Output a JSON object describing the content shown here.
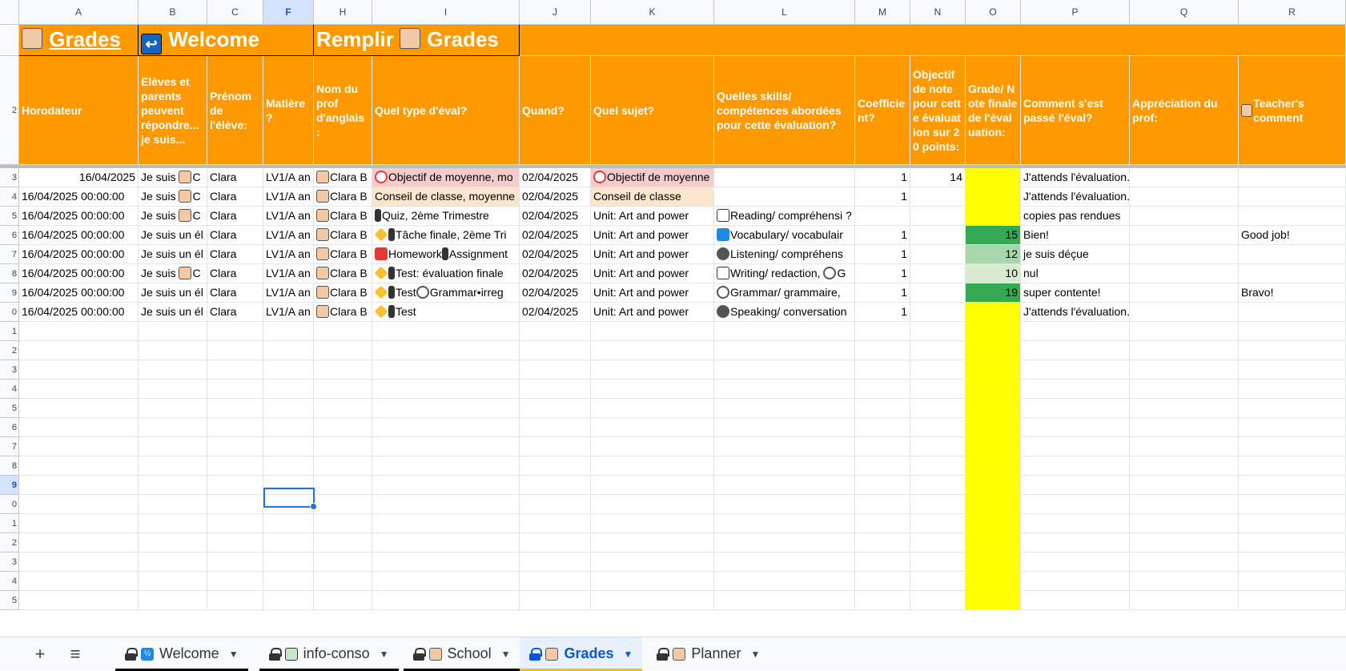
{
  "columns": [
    "A",
    "B",
    "C",
    "F",
    "H",
    "I",
    "J",
    "K",
    "L",
    "M",
    "N",
    "O",
    "P",
    "Q",
    "R"
  ],
  "selected_column": "F",
  "row_numbers": [
    "2",
    "3",
    "4",
    "5",
    "6",
    "7",
    "8",
    "9",
    "0",
    "1",
    "2",
    "3",
    "4",
    "5",
    "6",
    "7",
    "8",
    "9",
    "0",
    "1",
    "2",
    "3",
    "4",
    "5"
  ],
  "selected_row_label": "9",
  "banner": {
    "grades_link": "Grades",
    "welcome": "Welcome",
    "remplir": "Remplir",
    "grades2": "Grades"
  },
  "headers": {
    "horodateur": "Horodateur",
    "eleves": "Elèves et parents peuvent répondre... je suis...",
    "prenom": "Prénom de l'élève:",
    "matiere": "Matière ?",
    "nom_prof": "Nom du prof d'anglais :",
    "type_eval": "Quel type d'éval?",
    "quand": "Quand?",
    "sujet": "Quel sujet?",
    "skills": "Quelles skills/ compétences abordées pour cette évaluation?",
    "coeff": "Coefficient?",
    "objectif": "Objectif de note pour cette évaluation sur 20 points:",
    "grade": "Grade/ Note finale de l'évaluation:",
    "comment": "Comment s'est passé l'éval?",
    "appreciation": "Appréciation du prof:",
    "teacher_comment": "Teacher's comment"
  },
  "rows": [
    {
      "a": "16/04/2025",
      "b": "Je suis",
      "b2": "C",
      "c": "Clara",
      "f": "LV1/A an",
      "h": "Clara B",
      "i": "Objectif de moyenne, mo",
      "j": "02/04/2025",
      "k": "Objectif de moyenne",
      "l": "",
      "m": "1",
      "n": "14",
      "o": "",
      "p": "J'attends l'évaluation.",
      "r": ""
    },
    {
      "a": "16/04/2025 00:00:00",
      "b": "Je suis",
      "b2": "C",
      "c": "Clara",
      "f": "LV1/A an",
      "h": "Clara B",
      "i": "Conseil de classe, moyenne",
      "j": "02/04/2025",
      "k": "Conseil de classe",
      "l": "",
      "m": "1",
      "n": "",
      "o": "",
      "p": "J'attends l'évaluation.",
      "r": ""
    },
    {
      "a": "16/04/2025 00:00:00",
      "b": "Je suis",
      "b2": "C",
      "c": "Clara",
      "f": "LV1/A an",
      "h": "Clara B",
      "i": "Quiz, 2ème Trimestre",
      "j": "02/04/2025",
      "k": "Unit: Art and power",
      "l": "Reading/ compréhensi",
      "l2": "?",
      "m": "",
      "n": "",
      "o": "",
      "p": "copies pas rendues",
      "r": ""
    },
    {
      "a": "16/04/2025 00:00:00",
      "b": "Je suis un él",
      "b2": "",
      "c": "Clara",
      "f": "LV1/A an",
      "h": "Clara B",
      "i": "Tâche finale, 2ème Tri",
      "j": "02/04/2025",
      "k": "Unit: Art and power",
      "l": "Vocabulary/ vocabulair",
      "m": "1",
      "n": "",
      "o": "15",
      "p": "Bien!",
      "r": "Good job!"
    },
    {
      "a": "16/04/2025 00:00:00",
      "b": "Je suis un él",
      "b2": "",
      "c": "Clara",
      "f": "LV1/A an",
      "h": "Clara B",
      "i": "Homework",
      "i2": "Assignment",
      "j": "02/04/2025",
      "k": "Unit: Art and power",
      "l": "Listening/ compréhens",
      "m": "1",
      "n": "",
      "o": "12",
      "p": "je suis déçue",
      "r": ""
    },
    {
      "a": "16/04/2025 00:00:00",
      "b": "Je suis",
      "b2": "C",
      "c": "Clara",
      "f": "LV1/A an",
      "h": "Clara B",
      "i": "Test: évaluation finale",
      "j": "02/04/2025",
      "k": "Unit: Art and power",
      "l": "Writing/ redaction,",
      "l2": "G",
      "m": "1",
      "n": "",
      "o": "10",
      "p": "nul",
      "r": ""
    },
    {
      "a": "16/04/2025 00:00:00",
      "b": "Je suis un él",
      "b2": "",
      "c": "Clara",
      "f": "LV1/A an",
      "h": "Clara B",
      "i": "Test",
      "i2": "Grammar•irreg",
      "j": "02/04/2025",
      "k": "Unit: Art and power",
      "l": "Grammar/ grammaire,",
      "m": "1",
      "n": "",
      "o": "19",
      "p": "super contente!",
      "r": "Bravo!"
    },
    {
      "a": "16/04/2025 00:00:00",
      "b": "Je suis un él",
      "b2": "",
      "c": "Clara",
      "f": "LV1/A an",
      "h": "Clara B",
      "i": "Test",
      "j": "02/04/2025",
      "k": "Unit: Art and power",
      "l": "Speaking/ conversation",
      "m": "1",
      "n": "",
      "o": "",
      "p": "J'attends l'évaluation.",
      "r": ""
    }
  ],
  "tabs": [
    {
      "label": "Welcome",
      "active": false
    },
    {
      "label": "info-conso",
      "active": false
    },
    {
      "label": "School",
      "active": false
    },
    {
      "label": "Grades",
      "active": true
    },
    {
      "label": "Planner",
      "active": false
    }
  ],
  "tabbar": {
    "add_symbol": "+",
    "menu_symbol": "≡",
    "caret": "▼"
  },
  "colors": {
    "header_orange": "#ff9900",
    "highlight_yellow": "#ffff00",
    "grade_high": "#34a853",
    "grade_mid": "#a8d5a9",
    "grade_low": "#d9ead3",
    "selection_blue": "#1a73e8"
  }
}
